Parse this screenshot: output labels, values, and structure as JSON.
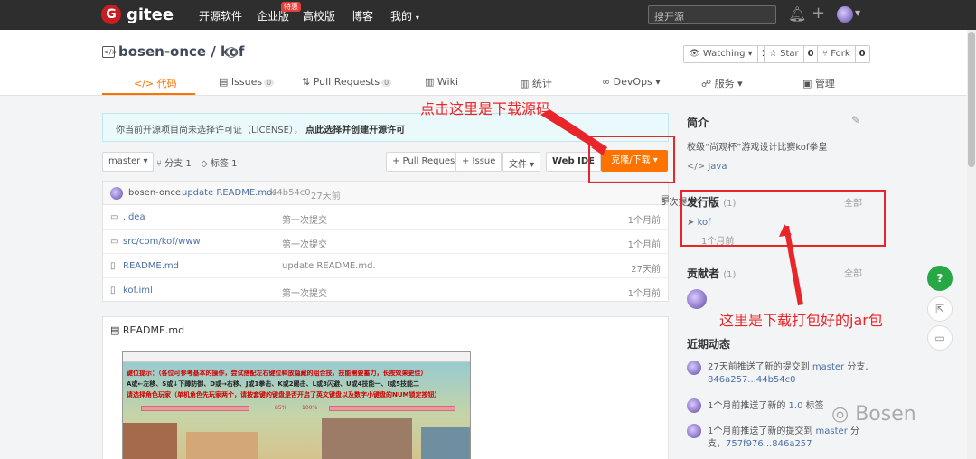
{
  "topnav": {
    "brand": "gitee",
    "logo_letter": "G",
    "items": [
      "开源软件",
      "企业版",
      "高校版",
      "博客",
      "我的"
    ],
    "enterprise_badge": "特惠",
    "search_placeholder": "搜开源"
  },
  "repo": {
    "title": "bosen-once / kof",
    "watching_label": "Watching",
    "watching_count": "1",
    "star_label": "Star",
    "star_count": "0",
    "fork_label": "Fork",
    "fork_count": "0"
  },
  "tabs": [
    {
      "label": "代码",
      "icon": "code-icon"
    },
    {
      "label": "Issues",
      "count": "0",
      "icon": "issues-icon"
    },
    {
      "label": "Pull Requests",
      "count": "0",
      "icon": "pull-request-icon"
    },
    {
      "label": "Wiki",
      "icon": "wiki-icon"
    },
    {
      "label": "统计",
      "icon": "stats-icon"
    },
    {
      "label": "DevOps",
      "icon": "devops-icon"
    },
    {
      "label": "服务",
      "icon": "service-icon"
    },
    {
      "label": "管理",
      "icon": "manage-icon"
    }
  ],
  "license_notice": {
    "text": "你当前开源项目尚未选择许可证（LICENSE），",
    "link": "点此选择并创建开源许可"
  },
  "toolbar": {
    "branch": "master",
    "branches": "分支 1",
    "tags": "标签 1",
    "pull_request": "+ Pull Request",
    "issue": "+ Issue",
    "file": "文件",
    "web_ide": "Web IDE",
    "clone": "克隆/下载"
  },
  "latest_commit": {
    "author": "bosen-once",
    "message": "update README.md.",
    "hash": "44b54c0",
    "time": "27天前",
    "commits": "3 次提交"
  },
  "files": [
    {
      "name": ".idea",
      "type": "folder",
      "message": "第一次提交",
      "time": "1个月前"
    },
    {
      "name": "src/com/kof/www",
      "type": "folder",
      "message": "第一次提交",
      "time": "1个月前"
    },
    {
      "name": "README.md",
      "type": "file",
      "message": "update README.md.",
      "time": "27天前"
    },
    {
      "name": "kof.iml",
      "type": "file",
      "message": "第一次提交",
      "time": "1个月前"
    }
  ],
  "readme": {
    "title": "README.md",
    "game_line1": "键位提示：（各位可参考基本的操作，尝试搭配左右键位释放隐藏的组合技，技能需要蓄力，长按效果更佳）",
    "game_line2": "A或←左移、S或↓下蹲防御、D或→右移、J或1拳击、K或2踢击、L或3闪避、U或4技能一、I或5技能二",
    "game_line3": "请选择角色玩家（单机角色先玩家两个，请按套键的键盘是否开启了英文键盘以及数字小键盘的NUM锁定按钮）",
    "hp_left": "85%",
    "hp_right": "100%"
  },
  "sidebar": {
    "intro_title": "简介",
    "intro_text": "校级“尚观杯”游戏设计比赛kof拳皇",
    "language": "Java",
    "releases_title": "发行版",
    "releases_count": "(1)",
    "releases_all": "全部",
    "release_name": "kof",
    "release_time": "1个月前",
    "contributors_title": "贡献者",
    "contributors_count": "(1)",
    "contributors_all": "全部",
    "activity_title": "近期动态",
    "activity": [
      {
        "line1": "27天前推送了新的提交到 ",
        "link1": "master",
        "tail1": " 分支,",
        "line2_link": "846a257...44b54c0"
      },
      {
        "line1": "1个月前推送了新的 ",
        "link1": "1.0",
        "tail1": " 标签",
        "line2_link": ""
      },
      {
        "line1": "1个月前推送了新的提交到 ",
        "link1": "master",
        "tail1": " 分",
        "line2_pre": "支，",
        "line2_link": "757f976...846a257"
      }
    ]
  },
  "annotations": {
    "download_source": "点击这里是下载源码",
    "download_jar": "这里是下载打包好的jar包",
    "color": "#e8262a"
  },
  "watermark": "Bosen",
  "colors": {
    "accent": "#fe7300",
    "nav_bg": "#2e2e2e",
    "link": "#4a6fa5",
    "help_button": "#28a745"
  }
}
